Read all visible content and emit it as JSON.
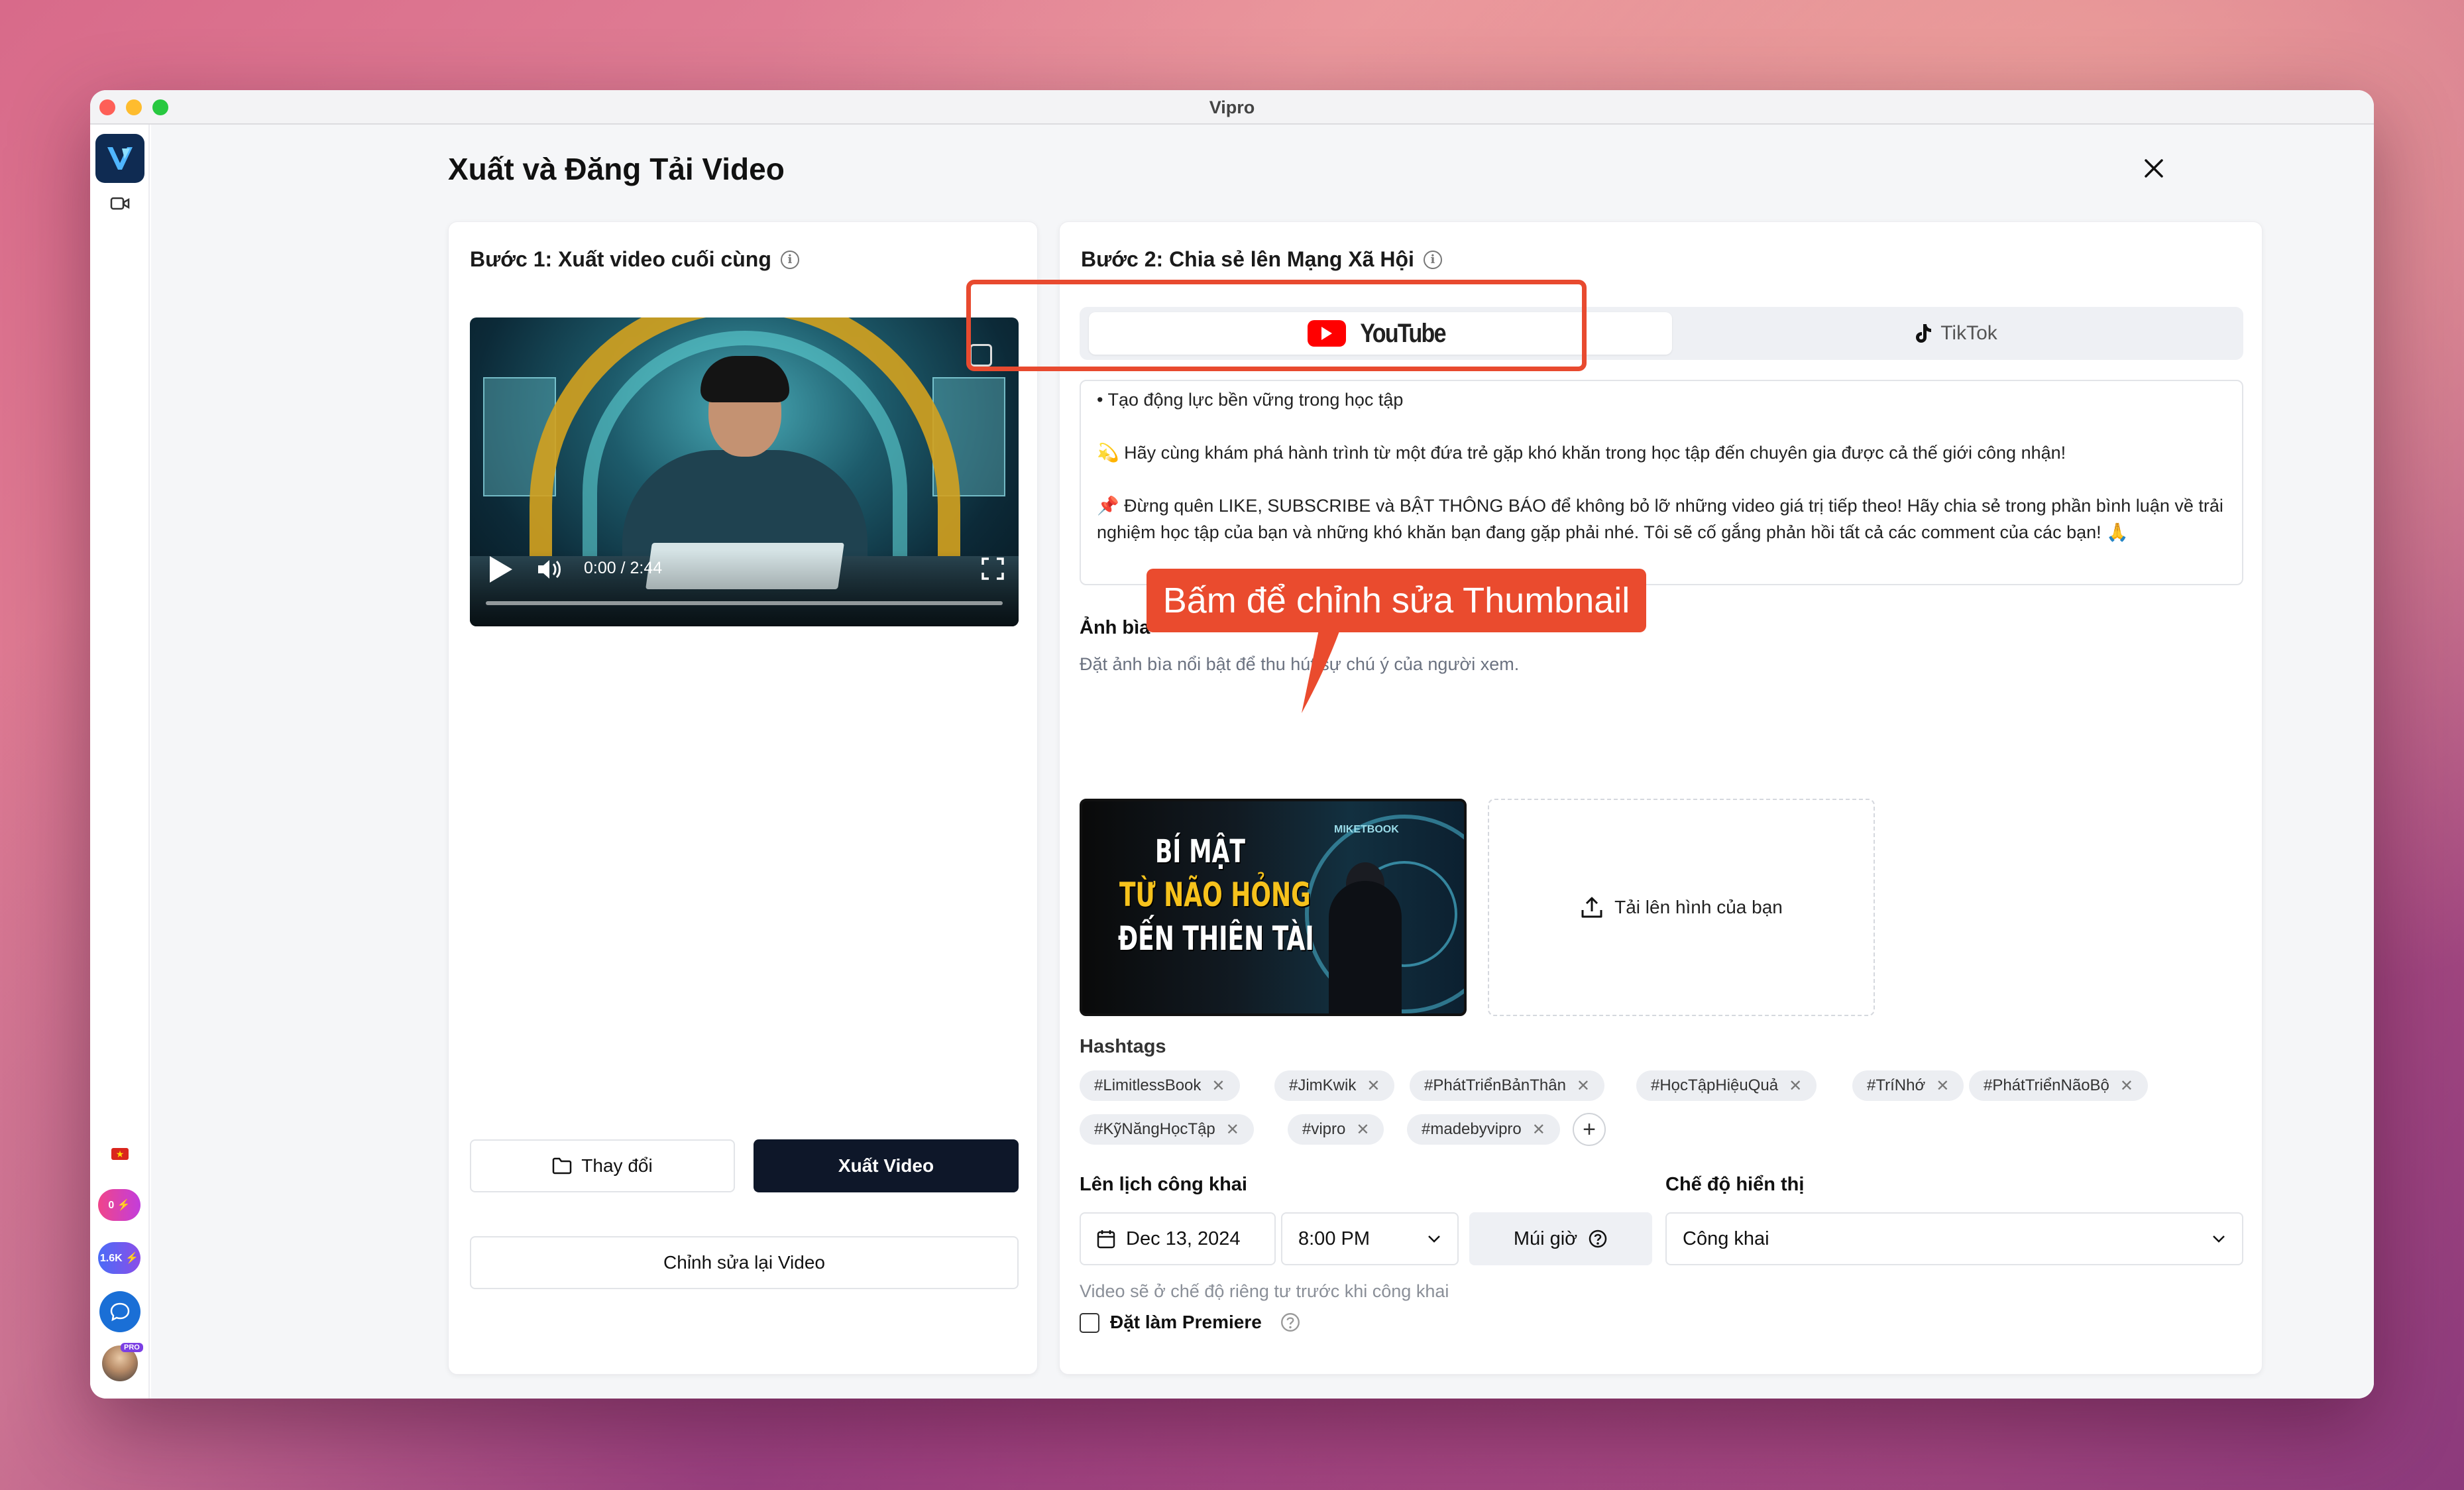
{
  "window": {
    "title": "Vipro"
  },
  "sidebar": {
    "badge_coins": "0 ⚡",
    "badge_count": "1.6K ⚡",
    "pro_label": "PRO"
  },
  "page": {
    "title": "Xuất và Đăng Tải Video"
  },
  "step1": {
    "title": "Bước 1: Xuất video cuối cùng",
    "video_time": "0:00 / 2:44",
    "change_label": "Thay đổi",
    "export_label": "Xuất Video",
    "edit_label": "Chỉnh sửa lại Video"
  },
  "step2": {
    "title": "Bước 2: Chia sẻ lên Mạng Xã Hội",
    "tabs": {
      "youtube": "YouTube",
      "tiktok": "TikTok",
      "active": "youtube"
    },
    "description_lines": [
      "• Tạo động lực bền vững trong học tập",
      "💫 Hãy cùng khám phá hành trình từ một đứa trẻ gặp khó khăn trong học tập đến chuyên gia được cả thế giới công nhận!",
      "📌 Đừng quên LIKE, SUBSCRIBE và BẬT THÔNG BÁO để không bỏ lỡ những video giá trị tiếp theo! Hãy chia sẻ trong phần bình luận về trải nghiệm học tập của bạn và những khó khăn bạn đang gặp phải nhé. Tôi sẽ cố gắng phản hồi tất cả các comment của các bạn! 🙏"
    ],
    "cover": {
      "label": "Ảnh bìa",
      "hint": "Đặt ảnh bìa nổi bật để thu hút sự chú ý của người xem.",
      "thumb_line1": "BÍ MẬT",
      "thumb_line2": "TỪ NÃO HỎNG",
      "thumb_line3": "ĐẾN THIÊN TÀI",
      "thumb_brand": "MIKETBOOK",
      "upload_label": "Tải lên hình của bạn"
    },
    "callout": "Bấm để chỉnh sửa Thumbnail",
    "hashtags_label": "Hashtags",
    "hashtags": [
      "#LimitlessBook",
      "#JimKwik",
      "#PhátTriểnBảnThân",
      "#HọcTậpHiệuQuả",
      "#TríNhớ",
      "#PhátTriểnNãoBộ",
      "#KỹNăngHọcTập",
      "#vipro",
      "#madebyvipro"
    ],
    "schedule": {
      "label": "Lên lịch công khai",
      "date": "Dec 13, 2024",
      "time": "8:00 PM",
      "timezone_label": "Múi giờ",
      "note": "Video sẽ ở chế độ riêng tư trước khi công khai"
    },
    "visibility": {
      "label": "Chế độ hiển thị",
      "value": "Công khai"
    },
    "premiere": {
      "label": "Đặt làm Premiere",
      "checked": false
    }
  },
  "colors": {
    "accent_dark": "#0e1729",
    "callout": "#ea4b2e",
    "youtube_red": "#ff0000"
  }
}
